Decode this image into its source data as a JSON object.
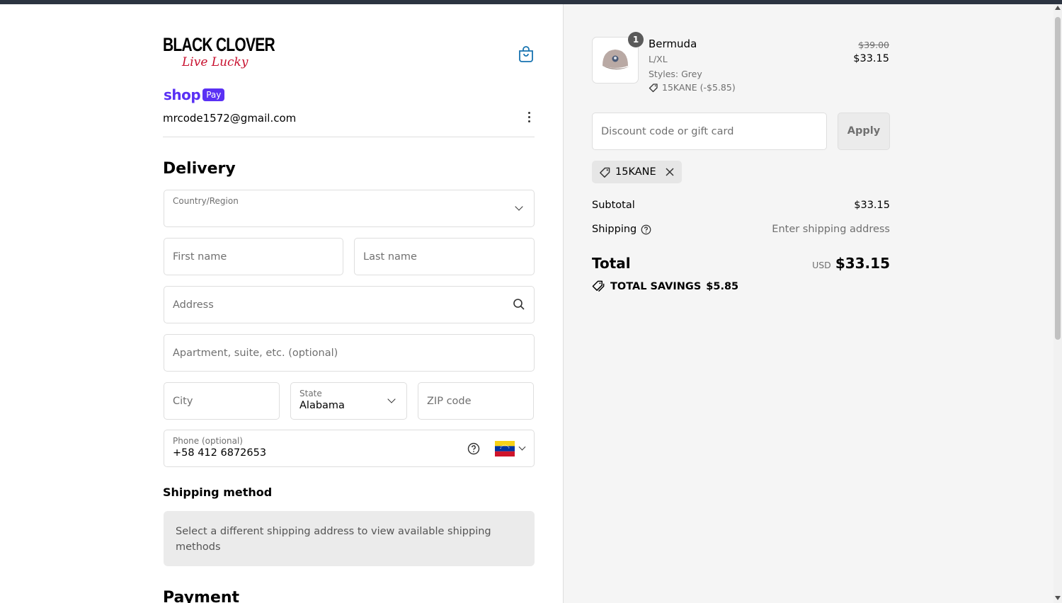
{
  "brand": {
    "logo_main": "BLACK CLOVER",
    "logo_script": "Live Lucky"
  },
  "shop_pay": {
    "shop_word": "shop",
    "pay_badge": "Pay"
  },
  "account": {
    "email": "mrcode1572@gmail.com"
  },
  "delivery": {
    "heading": "Delivery",
    "country_label": "Country/Region",
    "first_name_placeholder": "First name",
    "last_name_placeholder": "Last name",
    "address_placeholder": "Address",
    "apartment_placeholder": "Apartment, suite, etc. (optional)",
    "city_placeholder": "City",
    "state_label": "State",
    "state_value": "Alabama",
    "zip_placeholder": "ZIP code",
    "phone_label": "Phone (optional)",
    "phone_value": "+58 412 6872653"
  },
  "shipping_method": {
    "heading": "Shipping method",
    "message": "Select a different shipping address to view available shipping methods"
  },
  "payment": {
    "heading": "Payment"
  },
  "order": {
    "item": {
      "quantity": "1",
      "name": "Bermuda",
      "variant": "L/XL",
      "style": "Styles: Grey",
      "discount": "15KANE (-$5.85)",
      "original_price": "$39.00",
      "price": "$33.15"
    },
    "discount_placeholder": "Discount code or gift card",
    "apply_label": "Apply",
    "applied_code": "15KANE",
    "subtotal_label": "Subtotal",
    "subtotal_value": "$33.15",
    "shipping_label": "Shipping",
    "shipping_value": "Enter shipping address",
    "total_label": "Total",
    "currency": "USD",
    "total_value": "$33.15",
    "savings_label": "TOTAL SAVINGS",
    "savings_value": "$5.85"
  },
  "colors": {
    "shop_pay_purple": "#5a31f4",
    "logo_red": "#c8102e",
    "link_blue": "#1773b0"
  }
}
